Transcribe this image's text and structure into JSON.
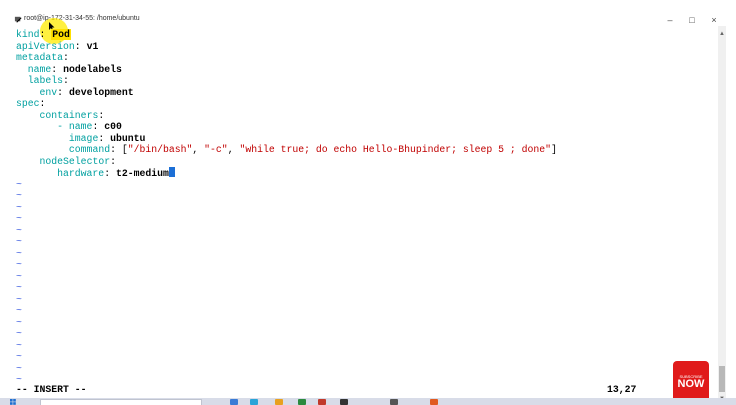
{
  "window": {
    "title": "root@ip-172-31-34-55: /home/ubuntu",
    "minimize_glyph": "–",
    "maximize_glyph": "□",
    "close_glyph": "×"
  },
  "editor": {
    "lines": [
      {
        "key": "kind",
        "colon": ": ",
        "value": "Pod",
        "indent": ""
      },
      {
        "key": "apiVersion",
        "colon": ": ",
        "value": "v1",
        "indent": ""
      },
      {
        "key": "metadata",
        "colon": ":",
        "value": "",
        "indent": ""
      },
      {
        "key": "name",
        "colon": ": ",
        "value": "nodelabels",
        "indent": "  "
      },
      {
        "key": "labels",
        "colon": ":",
        "value": "",
        "indent": "  "
      },
      {
        "key": "env",
        "colon": ": ",
        "value": "development",
        "indent": "    "
      },
      {
        "key": "spec",
        "colon": ":",
        "value": "",
        "indent": ""
      },
      {
        "key": "containers",
        "colon": ":",
        "value": "",
        "indent": "    "
      },
      {
        "key": "name",
        "colon": ": ",
        "value": "c00",
        "indent": "       - "
      },
      {
        "key": "image",
        "colon": ": ",
        "value": "ubuntu",
        "indent": "         "
      },
      {
        "key": "command",
        "colon": ": ",
        "value": "",
        "indent": "         "
      },
      {
        "key": "nodeSelector",
        "colon": ":",
        "value": "",
        "indent": "    "
      },
      {
        "key": "hardware",
        "colon": ": ",
        "value": "t2-medium",
        "indent": "       "
      }
    ],
    "command_parts": {
      "open": "[",
      "a1": "\"/bin/bash\"",
      "sep1": ", ",
      "a2": "\"-c\"",
      "sep2": ", ",
      "a3": "\"while true; do echo Hello-Bhupinder; sleep 5 ; done\"",
      "close": "]"
    },
    "empty_line_marker": "~"
  },
  "status_bar": {
    "mode": "-- INSERT --",
    "cursor_position": "13,27"
  },
  "overlay": {
    "subscribe_small": "SUBSCRIBE",
    "subscribe_now": "NOW"
  },
  "colors": {
    "key": "#00a0a0",
    "string": "#c00000",
    "tilde": "#4060e0",
    "highlight": "#ffe000",
    "caret": "#1c6fd6"
  }
}
